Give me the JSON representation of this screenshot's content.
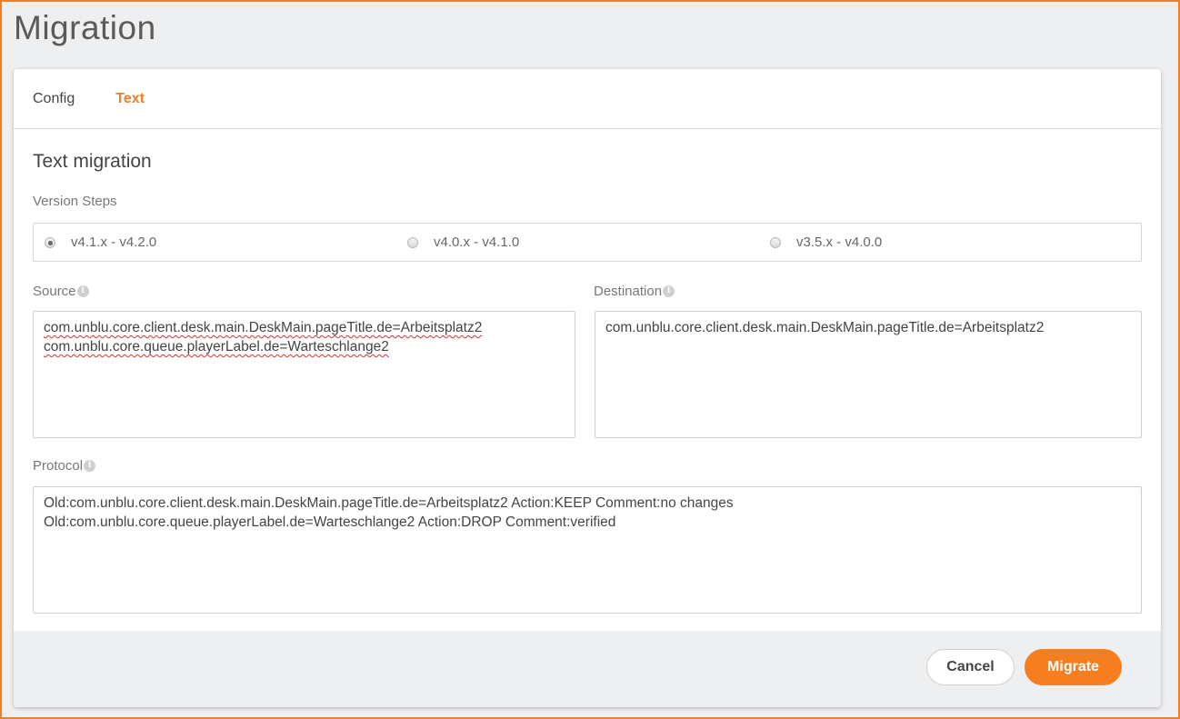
{
  "page": {
    "title": "Migration"
  },
  "tabs": [
    {
      "label": "Config",
      "active": false
    },
    {
      "label": "Text",
      "active": true
    }
  ],
  "section": {
    "title": "Text migration"
  },
  "version_steps": {
    "label": "Version Steps",
    "options": [
      {
        "label": "v4.1.x - v4.2.0",
        "checked": true
      },
      {
        "label": "v4.0.x - v4.1.0",
        "checked": false
      },
      {
        "label": "v3.5.x - v4.0.0",
        "checked": false
      }
    ]
  },
  "source": {
    "label": "Source",
    "lines": [
      "com.unblu.core.client.desk.main.DeskMain.pageTitle.de=Arbeitsplatz2",
      "com.unblu.core.queue.playerLabel.de=Warteschlange2"
    ]
  },
  "destination": {
    "label": "Destination",
    "lines": [
      "com.unblu.core.client.desk.main.DeskMain.pageTitle.de=Arbeitsplatz2"
    ]
  },
  "protocol": {
    "label": "Protocol",
    "lines": [
      "Old:com.unblu.core.client.desk.main.DeskMain.pageTitle.de=Arbeitsplatz2 Action:KEEP Comment:no changes",
      "Old:com.unblu.core.queue.playerLabel.de=Warteschlange2 Action:DROP Comment:verified"
    ]
  },
  "buttons": {
    "cancel": "Cancel",
    "migrate": "Migrate"
  },
  "colors": {
    "accent": "#f07f28",
    "migrate_button": "#f57f1f",
    "spellcheck_underline": "#e03030"
  },
  "icons": {
    "info": "info-icon"
  }
}
